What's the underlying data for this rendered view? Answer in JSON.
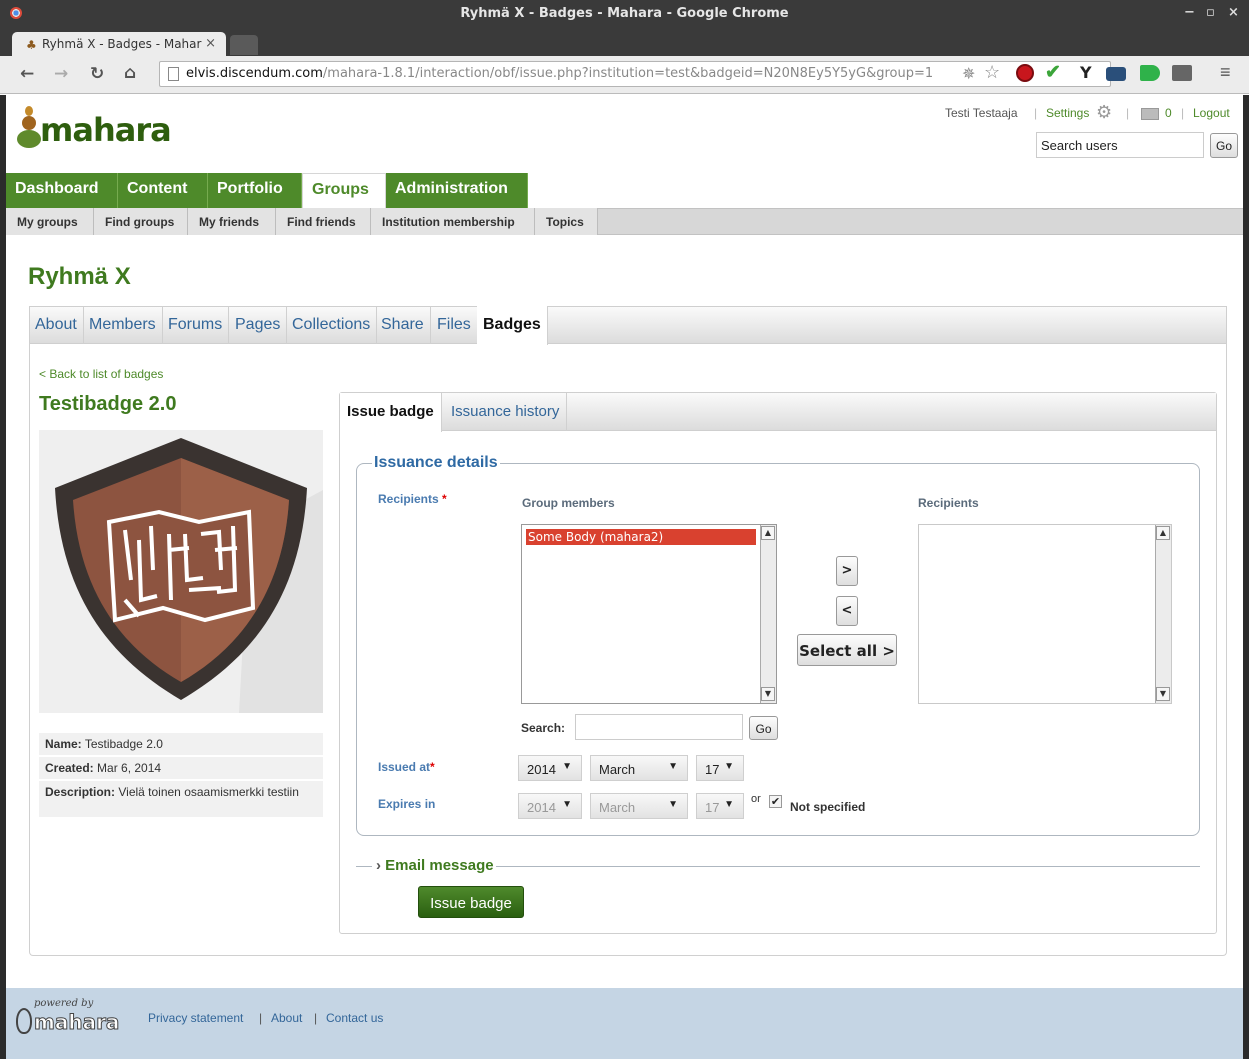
{
  "browser": {
    "window_title": "Ryhmä X - Badges - Mahara - Google Chrome",
    "tab_title": "Ryhmä X - Badges - Mahar",
    "url_host": "elvis.discendum.com",
    "url_path": "/mahara-1.8.1/interaction/obf/issue.php?institution=test&badgeid=N20N8Ey5Y5yG&group=1",
    "tab_close": "×",
    "window_controls": [
      "−",
      "▫",
      "×"
    ],
    "extension_icons": [
      "shield-stop-icon",
      "checkmark-icon",
      "y-icon",
      "camera-icon",
      "id-icon",
      "cast-icon"
    ]
  },
  "header": {
    "logo": "mahara",
    "user_name": "Testi Testaaja",
    "settings_label": "Settings",
    "inbox_count": "0",
    "logout_label": "Logout",
    "search_placeholder": "Search users",
    "search_go": "Go",
    "separator": "|"
  },
  "main_nav": [
    {
      "label": "Dashboard"
    },
    {
      "label": "Content"
    },
    {
      "label": "Portfolio"
    },
    {
      "label": "Groups",
      "active": true
    },
    {
      "label": "Administration"
    }
  ],
  "sub_nav": [
    {
      "label": "My groups"
    },
    {
      "label": "Find groups"
    },
    {
      "label": "My friends"
    },
    {
      "label": "Find friends"
    },
    {
      "label": "Institution membership"
    },
    {
      "label": "Topics"
    }
  ],
  "group": {
    "title": "Ryhmä X",
    "tabs": [
      {
        "label": "About"
      },
      {
        "label": "Members"
      },
      {
        "label": "Forums"
      },
      {
        "label": "Pages"
      },
      {
        "label": "Collections"
      },
      {
        "label": "Share"
      },
      {
        "label": "Files"
      },
      {
        "label": "Badges",
        "active": true
      }
    ]
  },
  "badge": {
    "back_link": "< Back to list of badges",
    "title": "Testibadge 2.0",
    "name_label": "Name:",
    "name_value": "Testibadge 2.0",
    "created_label": "Created:",
    "created_value": "Mar 6, 2014",
    "description_label": "Description:",
    "description_value": "Vielä toinen osaamismerkki testiin",
    "colors": {
      "shield_outer": "#3a3330",
      "shield_inner": "#8d5440",
      "map": "#ffffff",
      "image_bg": "#efefef"
    }
  },
  "issue": {
    "tabs": [
      {
        "label": "Issue badge",
        "active": true
      },
      {
        "label": "Issuance history"
      }
    ],
    "legend": "Issuance details",
    "recipients_label": "Recipients",
    "required_mark": "*",
    "group_members_header": "Group members",
    "recipients_header": "Recipients",
    "group_members": [
      "Some Body (mahara2)"
    ],
    "recipients": [],
    "move_right": ">",
    "move_left": "<",
    "select_all": "Select all >",
    "search_label": "Search:",
    "search_value": "",
    "search_go": "Go",
    "issued_at_label": "Issued at",
    "issued_year": "2014",
    "issued_month": "March",
    "issued_day": "17",
    "expires_label": "Expires in",
    "expires_year": "2014",
    "expires_month": "March",
    "expires_day": "17",
    "or_label": "or",
    "not_specified_label": "Not specified",
    "not_specified_checked": true,
    "email_legend": "Email message",
    "issue_button": "Issue badge",
    "colors": {
      "selected_member": "#d9412f",
      "legend": "#2f6aa4",
      "nav_green": "#4e8a2a",
      "button_green": "#2e6e14"
    }
  },
  "footer": {
    "powered_by": "powered by",
    "logo": "mahara",
    "links": [
      "Privacy statement",
      "About",
      "Contact us"
    ],
    "separator": "|"
  }
}
